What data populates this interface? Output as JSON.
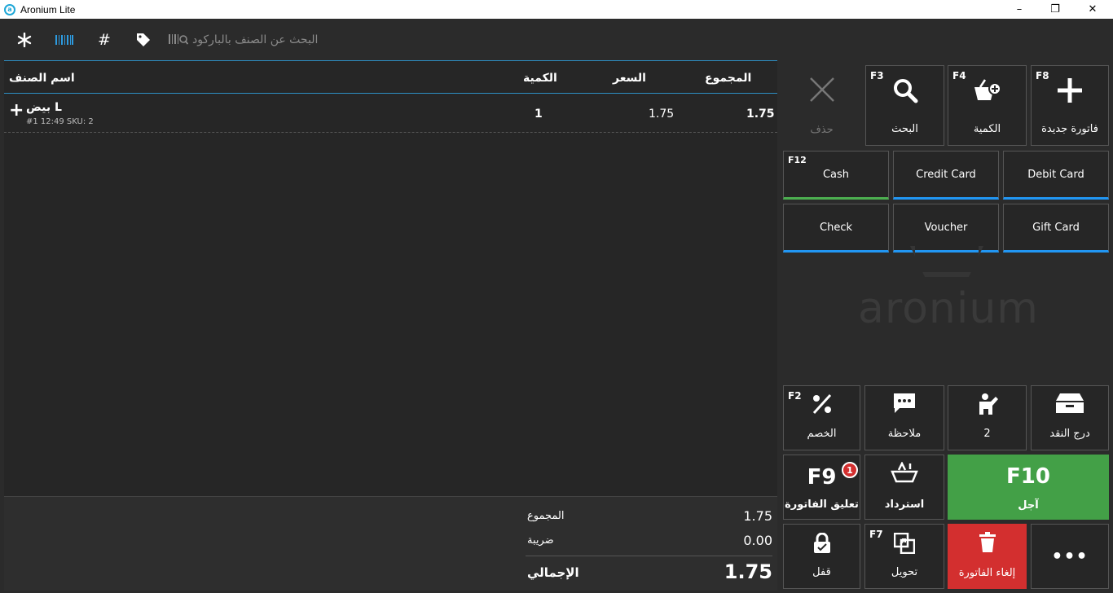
{
  "window": {
    "title": "Aronium Lite",
    "minimize": "–",
    "maximize": "❐",
    "close": "✕"
  },
  "toolbar": {
    "search_placeholder": "البحث عن الصنف بالباركود",
    "icons": [
      "asterisk-icon",
      "barcode-icon",
      "hash-icon",
      "tag-icon",
      "barcode-search-icon"
    ]
  },
  "table": {
    "headers": {
      "name": "اسم الصنف",
      "qty": "الكمية",
      "price": "السعر",
      "total": "المجموع"
    },
    "rows": [
      {
        "expand": "+",
        "name": "بيض L",
        "meta": "#1 12:49 SKU: 2",
        "qty": "1",
        "price": "1.75",
        "total": "1.75"
      }
    ]
  },
  "totals": {
    "subtotal_label": "المجموع",
    "subtotal_value": "1.75",
    "tax_label": "ضريبة",
    "tax_value": "0.00",
    "grand_label": "الإجمالي",
    "grand_value": "1.75"
  },
  "actions": {
    "delete": {
      "label": "حذف"
    },
    "search": {
      "fkey": "F3",
      "label": "البحث"
    },
    "quantity": {
      "fkey": "F4",
      "label": "الكمية"
    },
    "new_invoice": {
      "fkey": "F8",
      "label": "فاتورة جديدة"
    }
  },
  "payments": {
    "cash": {
      "fkey": "F12",
      "label": "Cash",
      "accent": "#4caf50"
    },
    "credit_card": {
      "label": "Credit Card",
      "accent": "#2196f3"
    },
    "debit_card": {
      "label": "Debit Card",
      "accent": "#2196f3"
    },
    "check": {
      "label": "Check",
      "accent": "#2196f3"
    },
    "voucher": {
      "label": "Voucher",
      "accent": "#2196f3"
    },
    "gift_card": {
      "label": "Gift Card",
      "accent": "#2196f3"
    }
  },
  "watermark": "aronium",
  "bottom": {
    "discount": {
      "fkey": "F2",
      "label": "الخصم"
    },
    "note": {
      "label": "ملاحظة"
    },
    "customer": {
      "label": "2"
    },
    "cash_drawer": {
      "label": "درج النقد"
    },
    "suspend": {
      "big": "F9",
      "label": "تعليق الفاتورة",
      "badge": "1"
    },
    "refund": {
      "label": "استرداد"
    },
    "pay_later": {
      "big": "F10",
      "label": "آجل",
      "color": "#43a047"
    },
    "lock": {
      "label": "قفل"
    },
    "transfer": {
      "fkey": "F7",
      "label": "تحويل"
    },
    "void": {
      "label": "إلغاء الفاتورة",
      "color": "#d32f2f"
    },
    "more": {
      "label": "•••"
    }
  }
}
